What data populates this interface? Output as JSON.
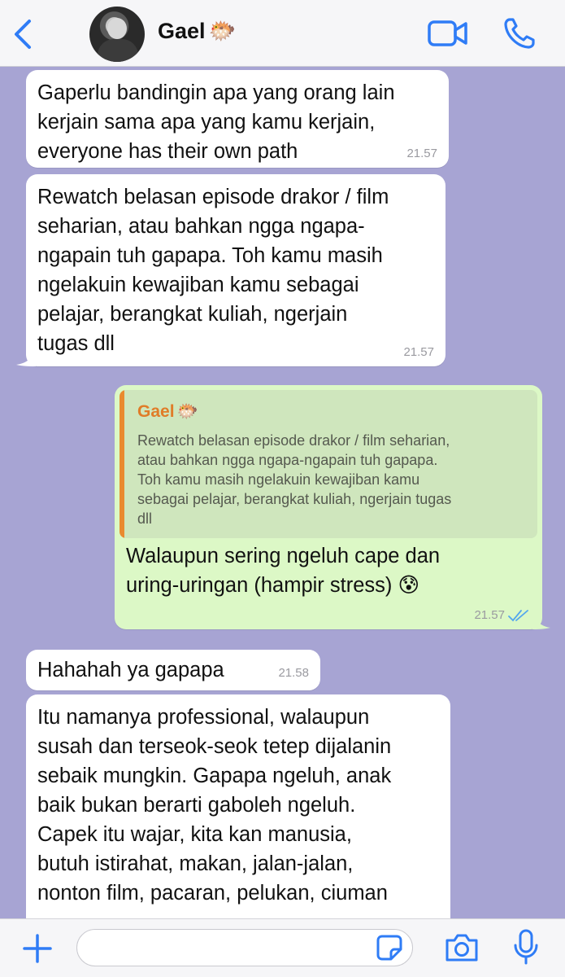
{
  "header": {
    "contact_name": "Gael",
    "contact_emoji": "🐡",
    "icons": {
      "back": "back-chevron-icon",
      "video": "video-call-icon",
      "phone": "phone-call-icon"
    },
    "accent": "#2f7cf6"
  },
  "messages": [
    {
      "direction": "in",
      "text": "Gaperlu bandingin apa yang orang lain\nkerjain sama apa yang kamu kerjain,\neveryone has their own path",
      "time": "21.57"
    },
    {
      "direction": "in",
      "text": "Rewatch belasan episode drakor / film\nseharian, atau bahkan ngga ngapa-\nngapain tuh gapapa. Toh kamu masih\nngelakuin kewajiban kamu sebagai\npelajar, berangkat kuliah, ngerjain\ntugas dll",
      "time": "21.57"
    },
    {
      "direction": "out",
      "quote": {
        "name": "Gael",
        "emoji": "🐡",
        "text": "Rewatch belasan episode drakor / film seharian,\natau bahkan ngga ngapa-ngapain tuh gapapa.\nToh kamu masih ngelakuin kewajiban kamu\nsebagai pelajar, berangkat kuliah, ngerjain tugas\ndll"
      },
      "text": "Walaupun sering ngeluh cape dan\nuring-uringan (hampir stress) 😰",
      "time": "21.57",
      "status": "read-double-check-icon"
    },
    {
      "direction": "in",
      "text": "Hahahah ya gapapa",
      "time": "21.58"
    },
    {
      "direction": "in",
      "text": "Itu namanya professional, walaupun\nsusah dan terseok-seok tetep dijalanin\nsebaik mungkin. Gapapa ngeluh, anak\nbaik bukan berarti gaboleh ngeluh.\nCapek itu wajar, kita kan manusia,\nbutuh istirahat, makan, jalan-jalan,\nnonton film, pacaran, pelukan, ciuman"
    }
  ],
  "input_bar": {
    "placeholder": "",
    "icons": {
      "add": "plus-icon",
      "sticker": "sticker-icon",
      "camera": "camera-icon",
      "mic": "microphone-icon"
    }
  },
  "colors": {
    "background": "#a7a4d3",
    "incoming_bubble": "#ffffff",
    "outgoing_bubble": "#dcf8c6",
    "quote_accent": "#e98a2f",
    "icon_blue": "#2f7cf6",
    "read_check": "#53a6ee"
  }
}
